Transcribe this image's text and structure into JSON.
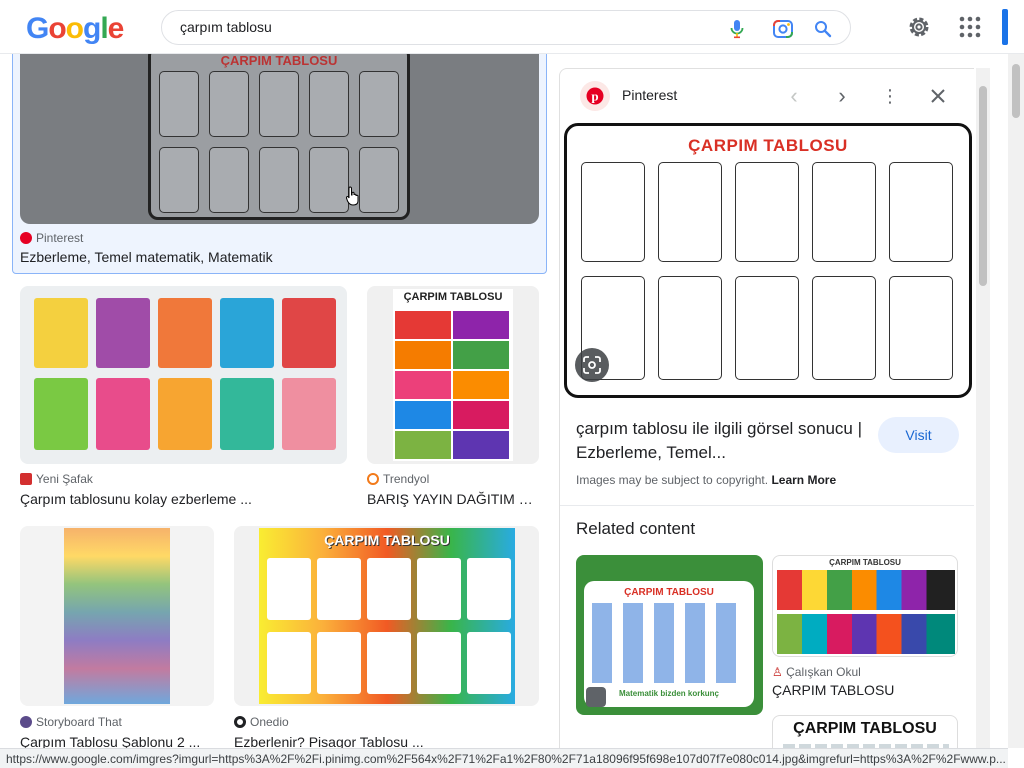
{
  "header": {
    "logo": "Google",
    "search_value": "çarpım tablosu"
  },
  "results": [
    {
      "source": "Pinterest",
      "title": "Ezberleme, Temel matematik, Matematik",
      "thumb_title": "ÇARPIM TABLOSU"
    },
    {
      "source": "Yeni Şafak",
      "title": "Çarpım tablosunu kolay ezberleme ..."
    },
    {
      "source": "Trendyol",
      "title": "BARIŞ YAYIN DAĞITIM E...",
      "thumb_title": "ÇARPIM TABLOSU"
    },
    {
      "source": "Storyboard That",
      "title": "Çarpım Tablosu Şablonu 2 ..."
    },
    {
      "source": "Onedio",
      "title": "Ezberlenir? Pisagor Tablosu ...",
      "thumb_title": "ÇARPIM TABLOSU"
    }
  ],
  "panel": {
    "source": "Pinterest",
    "image_title": "ÇARPIM TABLOSU",
    "title": "çarpım tablosu ile ilgili görsel sonucu | Ezberleme, Temel...",
    "visit_label": "Visit",
    "copyright": "Images may be subject to copyright.",
    "learn_more": "Learn More",
    "related_heading": "Related content",
    "related": [
      {
        "thumb_title": "ÇARPIM TABLOSU",
        "footer": "Matematik bizden korkunç"
      },
      {
        "source": "Çalışkan Okul",
        "title": "ÇARPIM TABLOSU",
        "thumb_title": "ÇARPIM TABLOSU"
      },
      {
        "thumb_title": "ÇARPIM TABLOSU"
      }
    ]
  },
  "status_url": "https://www.google.com/imgres?imgurl=https%3A%2F%2Fi.pinimg.com%2F564x%2F71%2Fa1%2F80%2F71a18096f95f698e107d07f7e080c014.jpg&imgrefurl=https%3A%2F%2Fwww.p...",
  "colors": {
    "accent": "#1a73e8",
    "title_red": "#d93025",
    "pinterest": "#e60023"
  }
}
